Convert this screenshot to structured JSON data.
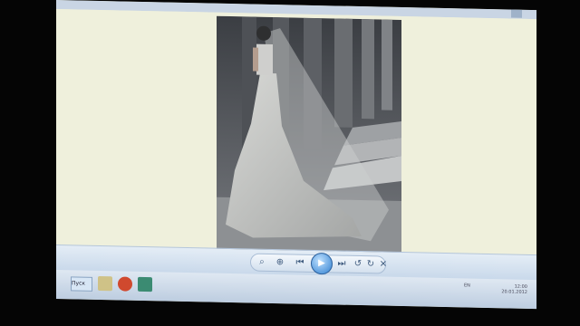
{
  "taskbar": {
    "start_label": "Пуск",
    "clock_time": "12:00",
    "clock_date": "20.01.2012",
    "lang": "EN"
  },
  "viewer_controls": [
    {
      "name": "zoom-icon",
      "glyph": "⌕"
    },
    {
      "name": "actual-size-icon",
      "glyph": "⊕"
    },
    {
      "name": "previous-icon",
      "glyph": "⏮"
    },
    {
      "name": "play-slideshow-icon",
      "glyph": "▶"
    },
    {
      "name": "next-icon",
      "glyph": "⏭"
    },
    {
      "name": "rotate-left-icon",
      "glyph": "↺"
    },
    {
      "name": "rotate-right-icon",
      "glyph": "↻"
    },
    {
      "name": "delete-icon",
      "glyph": "✕"
    }
  ],
  "photo": {
    "subject": "bride in white gown with long veil among tall columns"
  },
  "colors": {
    "screen_bg": "#eff0dc",
    "toolbar": "#d6e3f0",
    "play_button": "#2f7fd0"
  }
}
